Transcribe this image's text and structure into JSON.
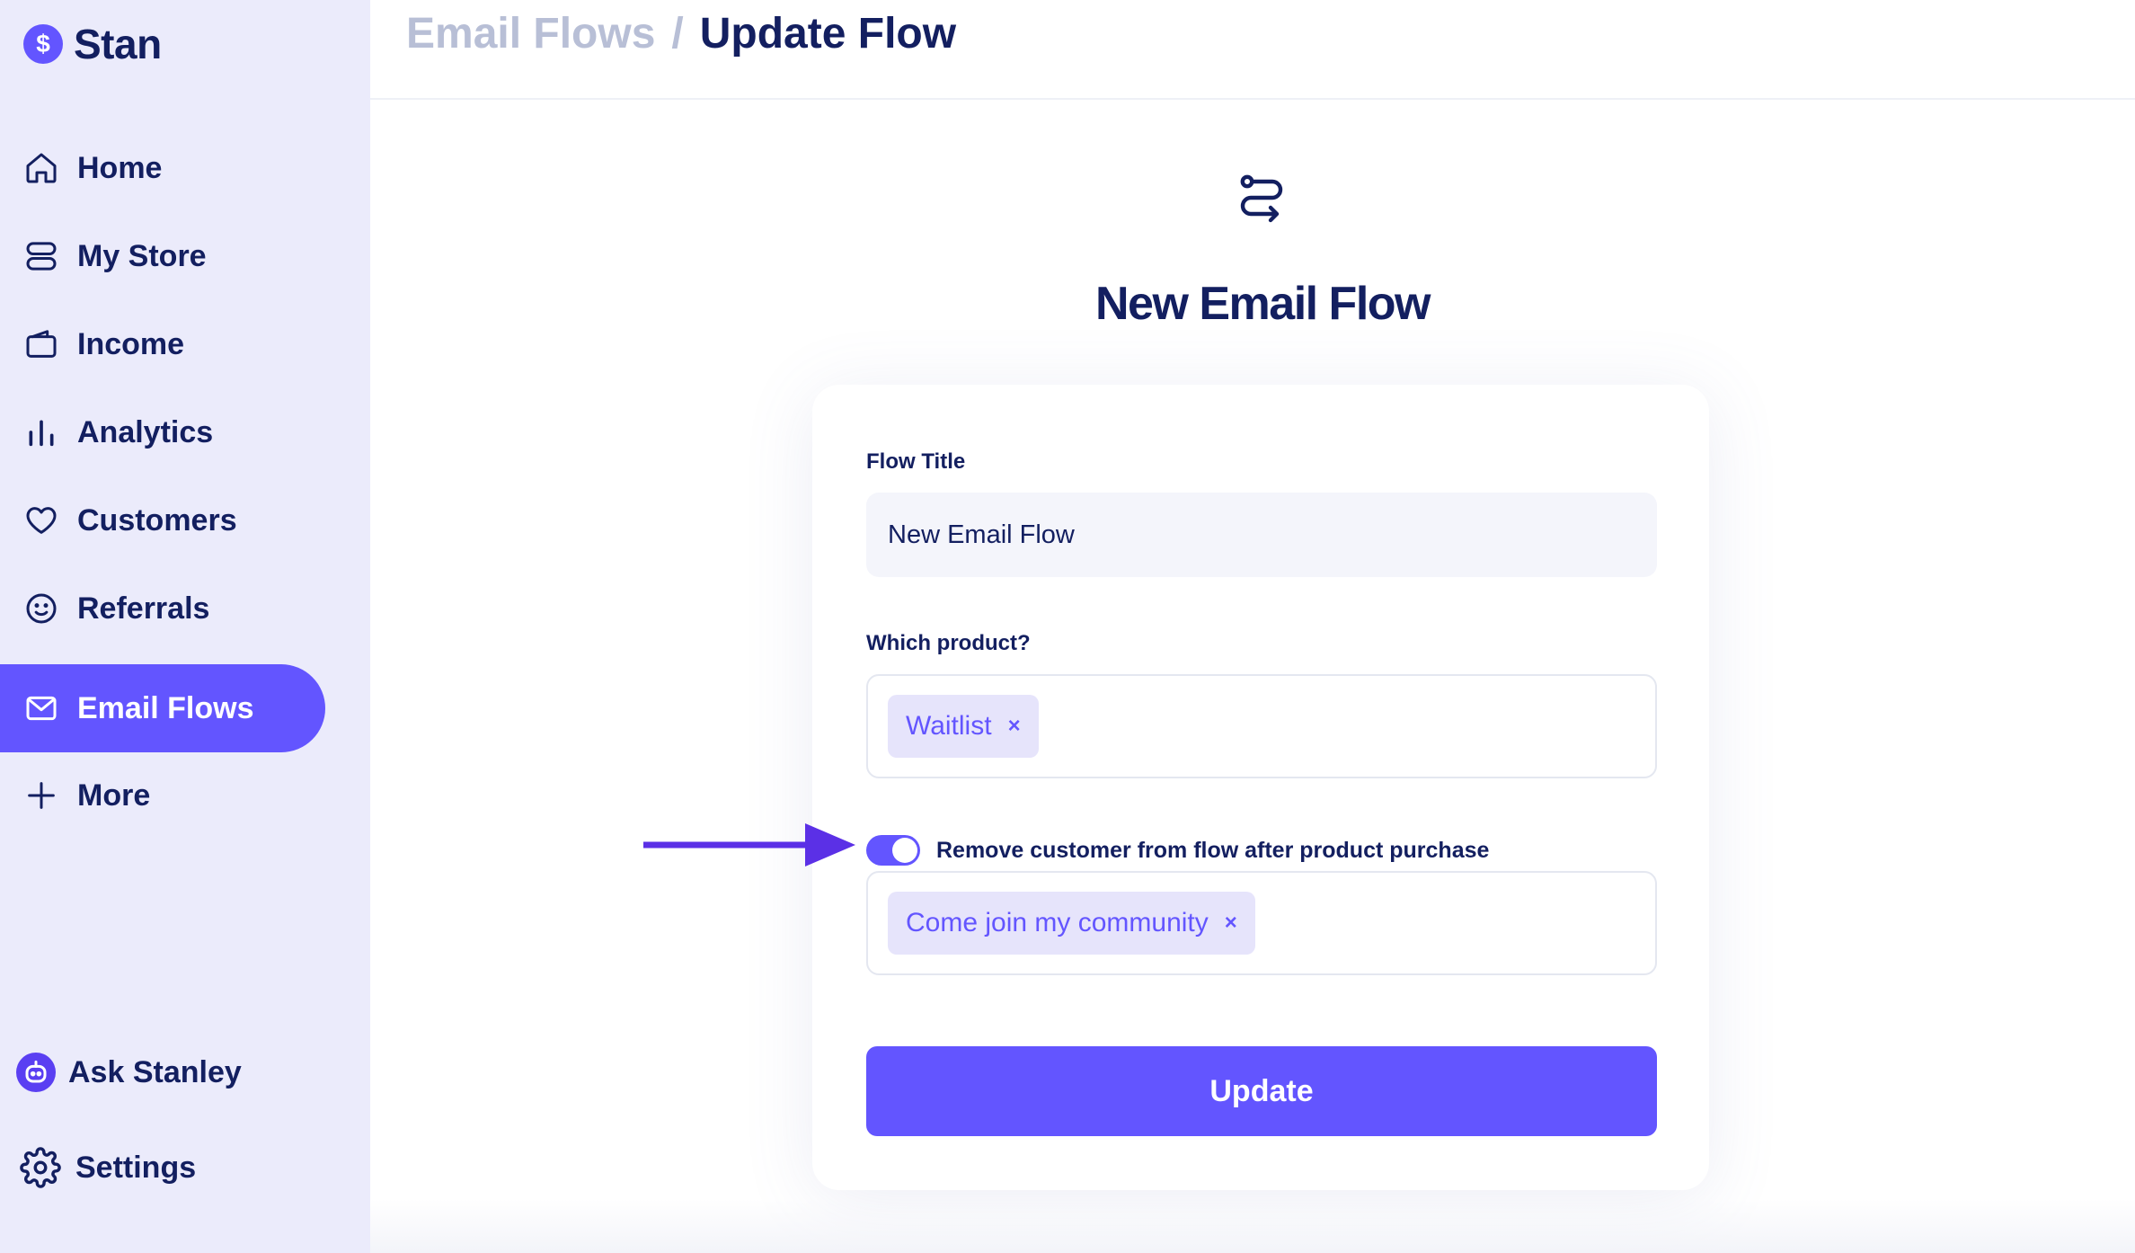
{
  "brand": {
    "name": "Stan",
    "logo_glyph": "$",
    "accent": "#6355ff"
  },
  "sidebar": {
    "items": [
      {
        "label": "Home",
        "icon": "home-icon"
      },
      {
        "label": "My Store",
        "icon": "store-icon"
      },
      {
        "label": "Income",
        "icon": "wallet-icon"
      },
      {
        "label": "Analytics",
        "icon": "bar-chart-icon"
      },
      {
        "label": "Customers",
        "icon": "heart-icon"
      },
      {
        "label": "Referrals",
        "icon": "smiley-icon"
      },
      {
        "label": "Email Flows",
        "icon": "mail-icon",
        "active": true
      },
      {
        "label": "More",
        "icon": "plus-icon"
      }
    ],
    "bottom": [
      {
        "label": "Ask Stanley",
        "icon": "stanley-avatar-icon"
      },
      {
        "label": "Settings",
        "icon": "gear-icon"
      }
    ]
  },
  "header": {
    "breadcrumb_parent": "Email Flows",
    "separator": "/",
    "breadcrumb_current": "Update Flow"
  },
  "main": {
    "icon": "flow-route-icon",
    "title": "New Email Flow"
  },
  "form": {
    "flow_title_label": "Flow Title",
    "flow_title_value": "New Email Flow",
    "product_label": "Which product?",
    "product_tags": [
      "Waitlist"
    ],
    "remove_toggle_on": true,
    "remove_toggle_label": "Remove customer from flow after product purchase",
    "removal_tags": [
      "Come join my community"
    ],
    "tag_remove_glyph": "×",
    "submit_label": "Update"
  },
  "annotation": {
    "type": "arrow",
    "points_to": "remove-customer-toggle",
    "color": "#5b30e6"
  },
  "colors": {
    "sidebar_bg": "#ebebfb",
    "text_dark": "#131f60",
    "muted": "#b8bfd6",
    "tag_bg": "#e6e4fb"
  }
}
